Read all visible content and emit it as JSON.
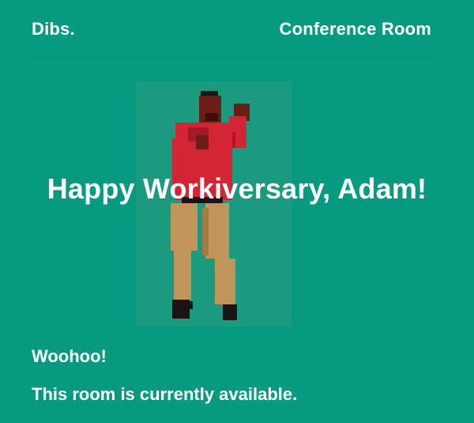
{
  "header": {
    "brand": "Dibs.",
    "room_name": "Conference Room"
  },
  "banner": {
    "message": "Happy Workiversary, Adam!"
  },
  "footer": {
    "cheer": "Woohoo!",
    "status": "This room is currently available."
  },
  "colors": {
    "background": "#069b80",
    "panel": "#1a9b80",
    "shirt": "#d42535",
    "skin": "#6b1e16",
    "pants": "#c19459",
    "shoes": "#1a1414",
    "text": "#ffffff"
  },
  "icons": {
    "dancer": "pixel-dancer-illustration"
  }
}
